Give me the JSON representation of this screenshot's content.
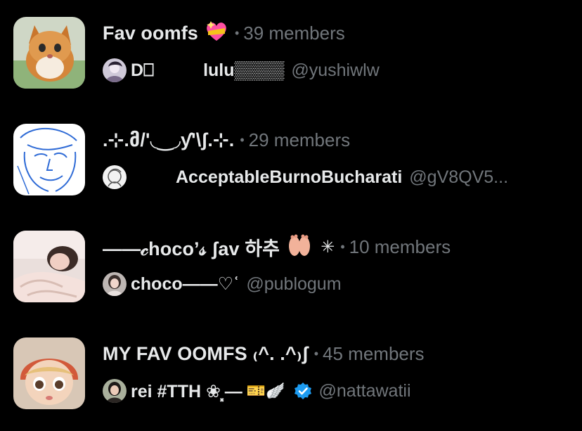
{
  "lists": [
    {
      "name": "Fav oomfs",
      "name_emoji": "sparkling-heart-icon",
      "separator": "•",
      "members": "39 members",
      "owner": {
        "prefix": "D⎕",
        "display_name": "lulu▒▒▒▒",
        "handle": "@yushiwlw"
      },
      "thumb_colors": {
        "bg": "#d9d2c4",
        "cat": "#d48a3c",
        "face": "#f3e2c9"
      }
    },
    {
      "name": ".⊹.მ/'◟‿◞ƴ'\\ʃ.⊹.",
      "separator": "•",
      "members": "29 members",
      "owner": {
        "display_name": "AcceptableBurnoBucharati",
        "handle": "@gV8QV5..."
      },
      "thumb_colors": {
        "bg": "#ffffff",
        "line": "#2f6bd6"
      }
    },
    {
      "name": "——𝒸hoco’𝓈 ʃav 하추",
      "name_emoji": "feet-icon",
      "name_emoji_2": "✳",
      "separator": "•",
      "members": "10 members",
      "owner": {
        "display_name": "choco——♡ʿ",
        "handle": "@publogum"
      },
      "thumb_colors": {
        "bg": "#e9dcd8",
        "skin": "#f1d3c9"
      }
    },
    {
      "name": "MY FAV OOMFS ₍^. .^₎ʃ",
      "separator": "•",
      "members": "45 members",
      "owner": {
        "display_name": "rei #TTH ❀⸼—",
        "extra": "🎫🪽",
        "handle": "@nattawatii"
      },
      "thumb_colors": {
        "bg": "#d9c8b8",
        "hat": "#d2593a",
        "face": "#f2d2b8"
      },
      "verified_color": "#1d9bf0"
    }
  ]
}
